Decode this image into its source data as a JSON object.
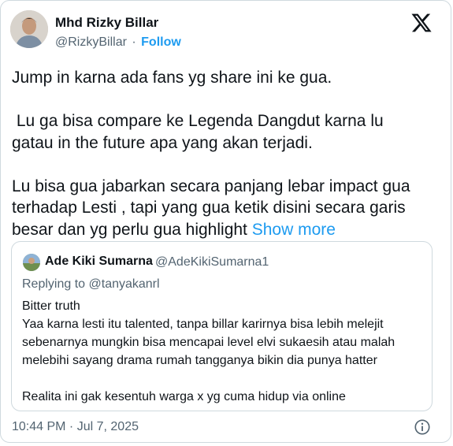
{
  "author": {
    "name": "Mhd Rizky Billar",
    "handle": "@RizkyBillar",
    "separator": "·",
    "follow_label": "Follow"
  },
  "brand_icon": "x-logo-icon",
  "tweet": {
    "line1": "Jump in karna ada fans yg share ini ke gua.",
    "line2": " Lu ga bisa compare ke Legenda Dangdut karna lu\ngatau in the future apa yang akan terjadi.",
    "line3": "Lu bisa gua jabarkan secara panjang lebar impact gua\nterhadap Lesti , tapi yang gua ketik disini secara garis\nbesar dan yg perlu gua highlight ",
    "show_more": "Show more"
  },
  "quote": {
    "name": "Ade Kiki Sumarna",
    "handle": "@AdeKikiSumarna1",
    "replying_prefix": "Replying to ",
    "replying_to": "@tanyakanrl",
    "lines": [
      "Bitter truth",
      "Yaa karna lesti itu talented, tanpa billar karirnya bisa lebih melejit",
      "sebenarnya mungkin bisa mencapai level elvi sukaesih atau malah",
      "melebihi sayang drama rumah tangganya bikin dia punya hatter",
      "Realita ini gak kesentuh warga x yg cuma hidup via online"
    ]
  },
  "timestamp": "10:44 PM · Jul 7, 2025",
  "colors": {
    "link": "#1d9bf0",
    "secondary_text": "#536471",
    "border": "#cfd9de"
  }
}
